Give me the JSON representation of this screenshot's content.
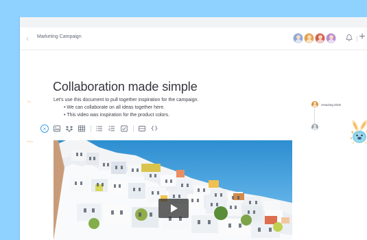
{
  "document": {
    "title": "Marketing Campaign",
    "heading": "Collaboration made simple",
    "authors": {
      "mine": "Tim",
      "other": "Olive"
    },
    "paragraph": "Let's use this document to pull together inspiration for the campaign.",
    "bullets": [
      "We can collaborate on all ideas together here.",
      "This video was inspiration for the product colors."
    ]
  },
  "header": {
    "icons": {
      "back": "chevron-left-icon",
      "notifications": "bell-icon",
      "add": "plus-icon"
    },
    "avatars": [
      {
        "color": "#8fa5d8"
      },
      {
        "color": "#e0a24f"
      },
      {
        "color": "#ce5d4e"
      },
      {
        "color": "#b58cd4"
      }
    ]
  },
  "toolbar": {
    "items": [
      "close-icon",
      "image-icon",
      "dropbox-icon",
      "table-icon",
      "bulleted-list-icon",
      "numbered-list-icon",
      "checklist-icon",
      "media-icon",
      "code-icon"
    ]
  },
  "comments": {
    "first": "Amazing shot!"
  },
  "media": {
    "type": "video",
    "play_icon": "play-icon"
  }
}
